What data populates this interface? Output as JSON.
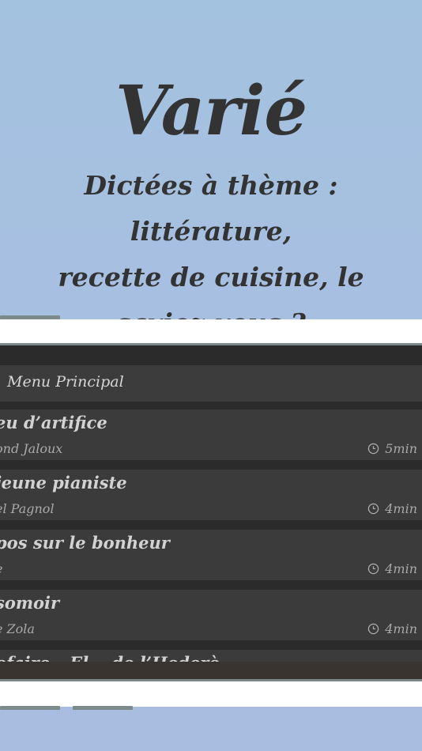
{
  "hero": {
    "title": "Varié",
    "subtitle_line1": "Dictées à thème : littérature,",
    "subtitle_line2": "recette de cuisine, le saviez-vous ?"
  },
  "menu": {
    "label": "Menu Principal"
  },
  "items": [
    {
      "title": "eu d’artifice",
      "author": "ond Jaloux",
      "duration": "5min"
    },
    {
      "title": "jeune pianiste",
      "author": "el Pagnol",
      "duration": "4min"
    },
    {
      "title": "pos sur le bonheur",
      "author": "e",
      "duration": "4min"
    },
    {
      "title": "somoir",
      "author": "e Zola",
      "duration": "4min"
    },
    {
      "title": "ofaire – El... de l’Hederè",
      "author": "",
      "duration": ""
    }
  ],
  "icons": {
    "clock": "clock-icon"
  },
  "colors": {
    "background_top": "#a3c2df",
    "text_dark": "#333333",
    "screen_bg": "#2b2b2b",
    "item_bg": "#3b3b3b"
  }
}
